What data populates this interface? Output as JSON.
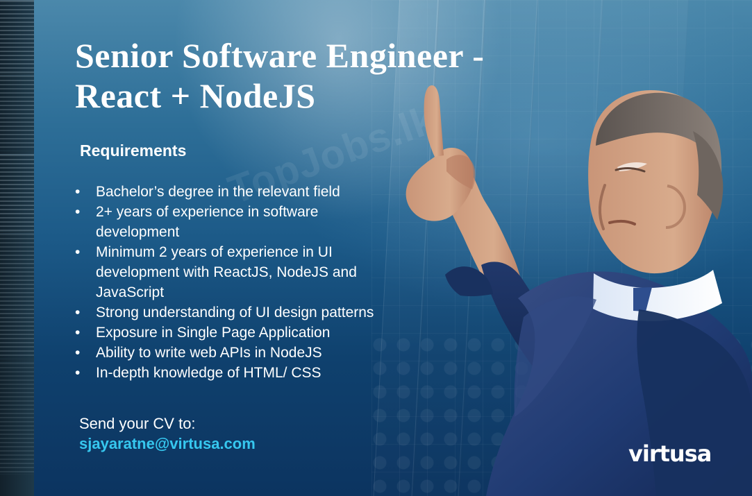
{
  "headline": {
    "line1": "Senior Software Engineer -",
    "line2": "React + NodeJS"
  },
  "requirements": {
    "title": "Requirements",
    "items": [
      "Bachelor’s degree in the relevant field",
      "2+ years of experience in software development",
      "Minimum 2 years of experience in UI development with ReactJS, NodeJS and JavaScript",
      "Strong understanding of UI design patterns",
      "Exposure in Single Page Application",
      "Ability to write web APIs in NodeJS",
      "In-depth knowledge of HTML/ CSS"
    ]
  },
  "contact": {
    "label": "Send your CV to:",
    "email": "sjayaratne@virtusa.com"
  },
  "watermark": {
    "text": "TopJobs.lk"
  },
  "logo": {
    "text": "virtusa"
  },
  "colors": {
    "accent": "#36c7ef",
    "primary_text": "#ffffff",
    "background": "#0c3460"
  },
  "icons": {
    "bullet": "bullet-icon",
    "logo": "virtusa-logo-icon"
  }
}
